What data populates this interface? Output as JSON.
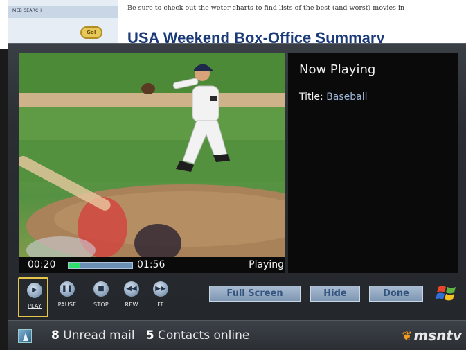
{
  "background_page": {
    "search_label": "MEB SEARCH",
    "go_label": "Go!",
    "note": "Be sure to check out the weter charts to find lists of the best (and worst) movies in",
    "headline": "USA Weekend Box-Office Summary"
  },
  "player": {
    "now_playing": "Now Playing",
    "title_label": "Title:",
    "title_value": "Baseball",
    "current_time": "00:20",
    "total_time": "01:56",
    "progress": 0.17,
    "state": "Playing",
    "controls": [
      {
        "label": "PLAY",
        "icon": "play-icon",
        "glyph": "▶",
        "active": true
      },
      {
        "label": "PAUSE",
        "icon": "pause-icon",
        "glyph": "❚❚",
        "active": false
      },
      {
        "label": "STOP",
        "icon": "stop-icon",
        "glyph": "■",
        "active": false
      },
      {
        "label": "REW",
        "icon": "rewind-icon",
        "glyph": "◀◀",
        "active": false
      },
      {
        "label": "FF",
        "icon": "fast-forward-icon",
        "glyph": "▶▶",
        "active": false
      }
    ],
    "buttons": {
      "full_screen": "Full Screen",
      "hide": "Hide",
      "done": "Done"
    }
  },
  "status_bar": {
    "unread_count": "8",
    "unread_label": "Unread mail",
    "contacts_count": "5",
    "contacts_label": "Contacts online",
    "logo_text": "msntv"
  },
  "colors": {
    "accent_selected": "#e6c64a",
    "progress_fill": "#2ee06a",
    "button_bg": "#8fa6c0",
    "title_value": "#9fb6d6"
  }
}
